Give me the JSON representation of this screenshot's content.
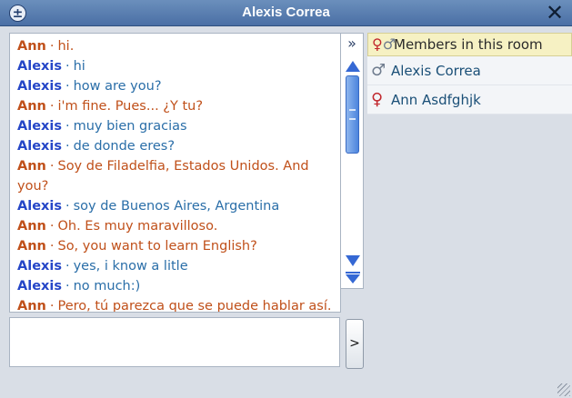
{
  "window": {
    "title": "Alexis Correa",
    "menu_icon": "plus-circle-icon",
    "close_icon": "close-icon",
    "close_glyph": "✕",
    "menu_glyph": "±"
  },
  "messages": [
    {
      "author": "Ann",
      "text": "hi.",
      "role": "ann"
    },
    {
      "author": "Alexis",
      "text": "hi",
      "role": "alexis"
    },
    {
      "author": "Alexis",
      "text": "how are you?",
      "role": "alexis"
    },
    {
      "author": "Ann",
      "text": "i'm fine. Pues... ¿Y tu?",
      "role": "ann"
    },
    {
      "author": "Alexis",
      "text": "muy bien gracias",
      "role": "alexis"
    },
    {
      "author": "Alexis",
      "text": "de donde eres?",
      "role": "alexis"
    },
    {
      "author": "Ann",
      "text": "Soy de Filadelfia, Estados Unidos. And you?",
      "role": "ann"
    },
    {
      "author": "Alexis",
      "text": "soy de Buenos Aires, Argentina",
      "role": "alexis"
    },
    {
      "author": "Ann",
      "text": "Oh. Es muy maravilloso.",
      "role": "ann"
    },
    {
      "author": "Ann",
      "text": "So, you want to learn English?",
      "role": "ann"
    },
    {
      "author": "Alexis",
      "text": "yes, i know a litle",
      "role": "alexis"
    },
    {
      "author": "Alexis",
      "text": "no much:)",
      "role": "alexis"
    },
    {
      "author": "Ann",
      "text": "Pero, tú parezca que se puede hablar así.",
      "role": "ann"
    }
  ],
  "separator": "·",
  "members": {
    "header_label": "Members in this room",
    "header_icon": "male-female-icon",
    "list": [
      {
        "name": "Alexis Correa",
        "icon": "male-icon",
        "gender": "male"
      },
      {
        "name": "Ann Asdfghjk",
        "icon": "female-icon",
        "gender": "female"
      }
    ]
  },
  "toolbar": {
    "expand_label": "»",
    "send_label": ">"
  },
  "input": {
    "value": "",
    "placeholder": ""
  }
}
